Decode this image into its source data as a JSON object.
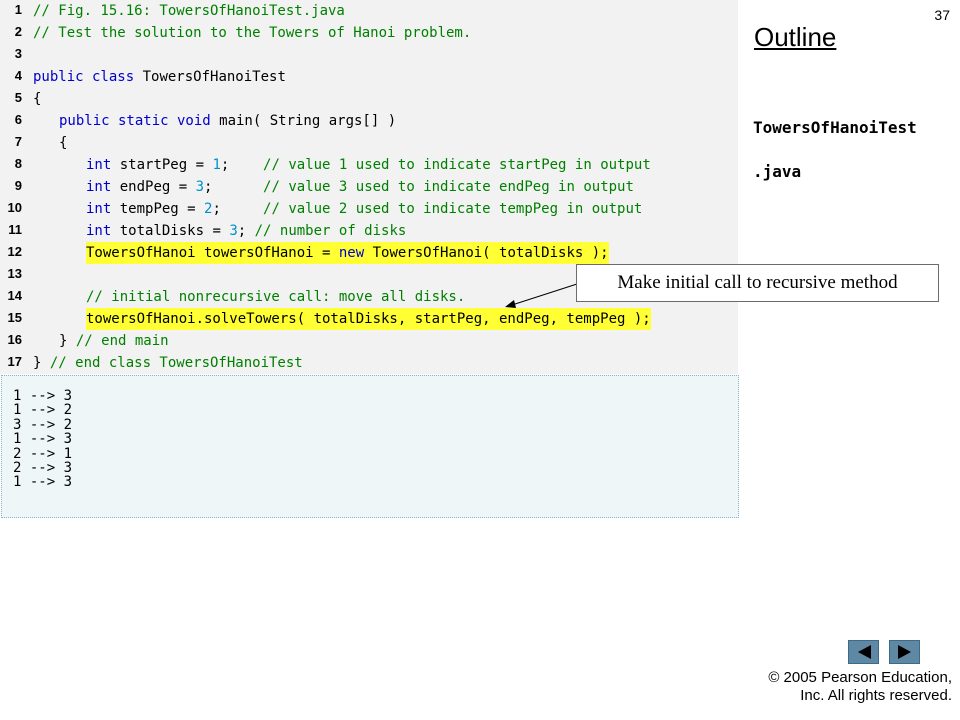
{
  "slide_number": "37",
  "outline_title": "Outline",
  "file_labels": [
    "TowersOfHanoiTest",
    ".java"
  ],
  "callout_text": "Make initial call to recursive method",
  "code_lines": [
    {
      "n": "1",
      "indent": 0,
      "highlight": false,
      "tokens": [
        {
          "t": "// Fig. 15.16: TowersOfHanoiTest.java",
          "c": "cm"
        }
      ]
    },
    {
      "n": "2",
      "indent": 0,
      "highlight": false,
      "tokens": [
        {
          "t": "// Test the solution to the Towers of Hanoi problem.",
          "c": "cm"
        }
      ]
    },
    {
      "n": "3",
      "indent": 0,
      "highlight": false,
      "tokens": []
    },
    {
      "n": "4",
      "indent": 0,
      "highlight": false,
      "tokens": [
        {
          "t": "public class",
          "c": "kw"
        },
        {
          "t": " TowersOfHanoiTest",
          "c": ""
        }
      ]
    },
    {
      "n": "5",
      "indent": 0,
      "highlight": false,
      "tokens": [
        {
          "t": "{",
          "c": ""
        }
      ]
    },
    {
      "n": "6",
      "indent": 1,
      "highlight": false,
      "tokens": [
        {
          "t": "public static void",
          "c": "kw"
        },
        {
          "t": " main( String args[] )",
          "c": ""
        }
      ]
    },
    {
      "n": "7",
      "indent": 1,
      "highlight": false,
      "tokens": [
        {
          "t": "{",
          "c": ""
        }
      ]
    },
    {
      "n": "8",
      "indent": 2,
      "highlight": false,
      "tokens": [
        {
          "t": "int",
          "c": "kw"
        },
        {
          "t": " startPeg = ",
          "c": ""
        },
        {
          "t": "1",
          "c": "num"
        },
        {
          "t": ";    ",
          "c": ""
        },
        {
          "t": "// value 1 used to indicate startPeg in output",
          "c": "cm"
        }
      ]
    },
    {
      "n": "9",
      "indent": 2,
      "highlight": false,
      "tokens": [
        {
          "t": "int",
          "c": "kw"
        },
        {
          "t": " endPeg = ",
          "c": ""
        },
        {
          "t": "3",
          "c": "num"
        },
        {
          "t": ";      ",
          "c": ""
        },
        {
          "t": "// value 3 used to indicate endPeg in output",
          "c": "cm"
        }
      ]
    },
    {
      "n": "10",
      "indent": 2,
      "highlight": false,
      "tokens": [
        {
          "t": "int",
          "c": "kw"
        },
        {
          "t": " tempPeg = ",
          "c": ""
        },
        {
          "t": "2",
          "c": "num"
        },
        {
          "t": ";     ",
          "c": ""
        },
        {
          "t": "// value 2 used to indicate tempPeg in output",
          "c": "cm"
        }
      ]
    },
    {
      "n": "11",
      "indent": 2,
      "highlight": false,
      "tokens": [
        {
          "t": "int",
          "c": "kw"
        },
        {
          "t": " totalDisks = ",
          "c": ""
        },
        {
          "t": "3",
          "c": "num"
        },
        {
          "t": "; ",
          "c": ""
        },
        {
          "t": "// number of disks",
          "c": "cm"
        }
      ]
    },
    {
      "n": "12",
      "indent": 2,
      "highlight": true,
      "tokens": [
        {
          "t": "TowersOfHanoi towersOfHanoi = ",
          "c": ""
        },
        {
          "t": "new",
          "c": "kw"
        },
        {
          "t": " TowersOfHanoi( totalDisks );",
          "c": ""
        }
      ]
    },
    {
      "n": "13",
      "indent": 0,
      "highlight": false,
      "tokens": []
    },
    {
      "n": "14",
      "indent": 2,
      "highlight": false,
      "tokens": [
        {
          "t": "// initial nonrecursive call: move all disks.",
          "c": "cm"
        }
      ]
    },
    {
      "n": "15",
      "indent": 2,
      "highlight": true,
      "tokens": [
        {
          "t": "towersOfHanoi.solveTowers( totalDisks, startPeg, endPeg, tempPeg );",
          "c": ""
        }
      ]
    },
    {
      "n": "16",
      "indent": 1,
      "highlight": false,
      "tokens": [
        {
          "t": "} ",
          "c": ""
        },
        {
          "t": "// end main",
          "c": "cm"
        }
      ]
    },
    {
      "n": "17",
      "indent": 0,
      "highlight": false,
      "tokens": [
        {
          "t": "} ",
          "c": ""
        },
        {
          "t": "// end class TowersOfHanoiTest",
          "c": "cm"
        }
      ]
    }
  ],
  "output_lines": [
    "1 --> 3",
    "1 --> 2",
    "3 --> 2",
    "1 --> 3",
    "2 --> 1",
    "2 --> 3",
    "1 --> 3"
  ],
  "nav": {
    "prev_icon": "left-arrow-icon",
    "next_icon": "right-arrow-icon"
  },
  "copyright": [
    "© 2005 Pearson Education,",
    "Inc.  All rights reserved."
  ],
  "colors": {
    "highlight": "#ffff33",
    "keyword": "#0000cc",
    "number": "#0090cc",
    "comment": "#008000",
    "code_bg": "#f2f2f2",
    "output_bg": "#eef6f8",
    "nav_button": "#5f88a4"
  }
}
